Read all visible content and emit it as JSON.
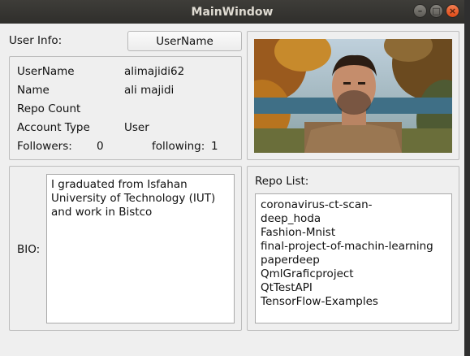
{
  "window": {
    "title": "MainWindow"
  },
  "user_info": {
    "label": "User Info:",
    "button_label": "UserName",
    "fields": [
      {
        "label": "UserName",
        "value": "alimajidi62"
      },
      {
        "label": "Name",
        "value": "ali majidi"
      },
      {
        "label": "Repo Count",
        "value": ""
      },
      {
        "label": "Account Type",
        "value": "User"
      }
    ],
    "followers_label": "Followers:",
    "followers_value": "0",
    "following_label": "following:",
    "following_value": "1"
  },
  "bio": {
    "label": "BIO:",
    "text": "I graduated from  Isfahan University of Technology (IUT) and work in Bistco"
  },
  "repo_list": {
    "label": "Repo List:",
    "items": [
      "coronavirus-ct-scan-",
      "deep_hoda",
      "Fashion-Mnist",
      "final-project-of-machin-learning",
      "paperdeep",
      "QmlGraficproject",
      "QtTestAPI",
      "TensorFlow-Examples"
    ]
  },
  "colors": {
    "titlebar": "#3c3b37",
    "window_bg": "#efefef",
    "close_button": "#e95420"
  },
  "icons": {
    "minimize": "minimize-icon",
    "maximize": "maximize-icon",
    "close": "close-icon"
  }
}
